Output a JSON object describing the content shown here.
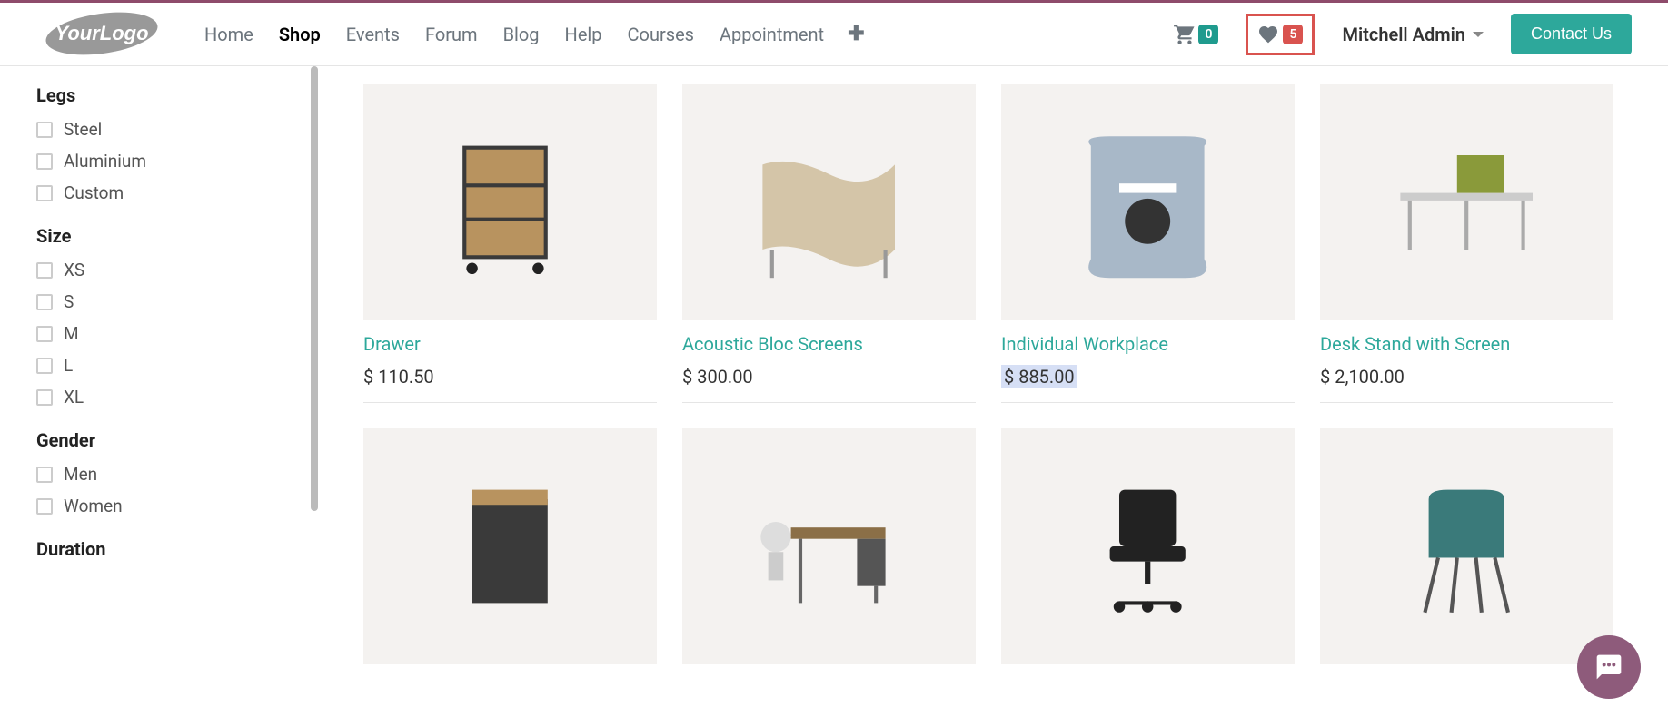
{
  "nav": {
    "items": [
      "Home",
      "Shop",
      "Events",
      "Forum",
      "Blog",
      "Help",
      "Courses",
      "Appointment"
    ],
    "active": "Shop"
  },
  "header": {
    "cart_count": "0",
    "wishlist_count": "5",
    "user_name": "Mitchell Admin",
    "contact_label": "Contact Us"
  },
  "filters": [
    {
      "title": "Legs",
      "options": [
        "Steel",
        "Aluminium",
        "Custom"
      ]
    },
    {
      "title": "Size",
      "options": [
        "XS",
        "S",
        "M",
        "L",
        "XL"
      ]
    },
    {
      "title": "Gender",
      "options": [
        "Men",
        "Women"
      ]
    },
    {
      "title": "Duration",
      "options": []
    }
  ],
  "products": [
    {
      "name": "Drawer",
      "price": "$ 110.50",
      "highlighted": false
    },
    {
      "name": "Acoustic Bloc Screens",
      "price": "$ 300.00",
      "highlighted": false
    },
    {
      "name": "Individual Workplace",
      "price": "$ 885.00",
      "highlighted": true
    },
    {
      "name": "Desk Stand with Screen",
      "price": "$ 2,100.00",
      "highlighted": false
    },
    {
      "name": "",
      "price": "",
      "highlighted": false
    },
    {
      "name": "",
      "price": "",
      "highlighted": false
    },
    {
      "name": "",
      "price": "",
      "highlighted": false
    },
    {
      "name": "",
      "price": "",
      "highlighted": false
    }
  ]
}
